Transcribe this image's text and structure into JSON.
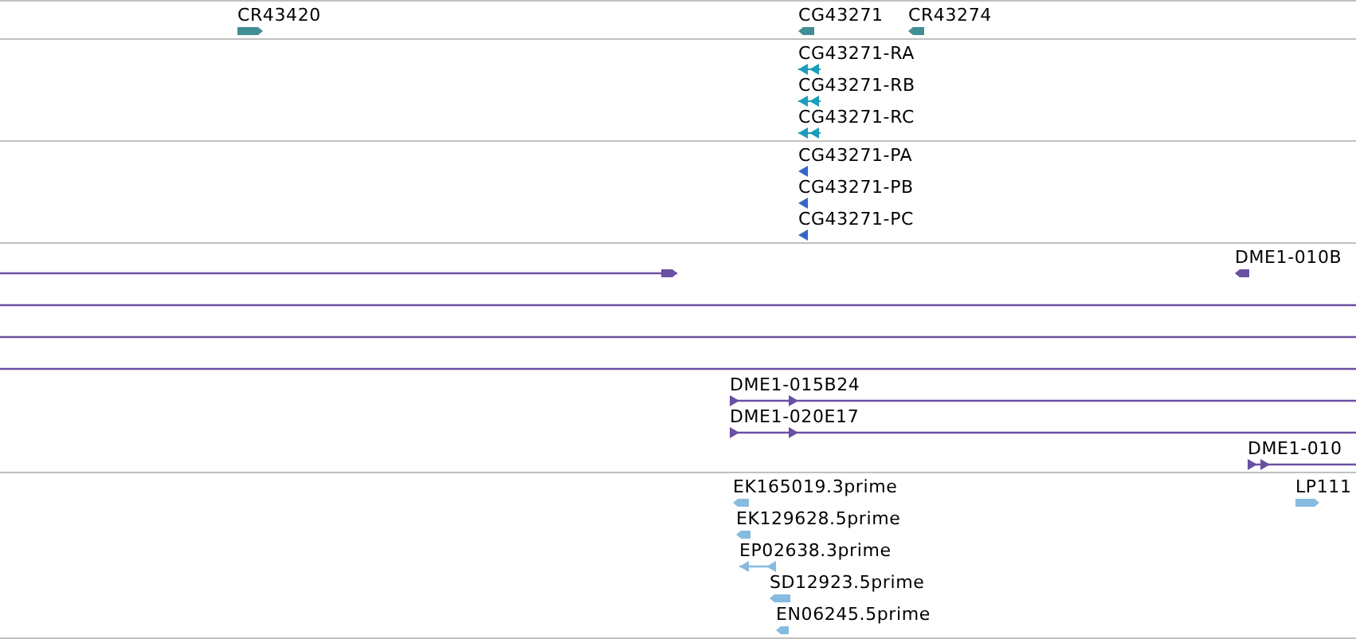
{
  "tracks": [
    {
      "color": "#3f8f94",
      "features": [
        {
          "label": "CR43420",
          "kind": "block",
          "reverse": false
        },
        {
          "label": "CG43271",
          "kind": "block",
          "reverse": true
        },
        {
          "label": "CR43274",
          "kind": "block",
          "reverse": true
        }
      ]
    },
    {
      "color": "#1a9dba",
      "features": [
        {
          "label": "CG43271-RA",
          "kind": "transcript",
          "reverse": true
        },
        {
          "label": "CG43271-RB",
          "kind": "transcript",
          "reverse": true
        },
        {
          "label": "CG43271-RC",
          "kind": "transcript",
          "reverse": true
        }
      ]
    },
    {
      "color": "#3366cc",
      "features": [
        {
          "label": "CG43271-PA",
          "kind": "cds",
          "reverse": true
        },
        {
          "label": "CG43271-PB",
          "kind": "cds",
          "reverse": true
        },
        {
          "label": "CG43271-PC",
          "kind": "cds",
          "reverse": true
        }
      ]
    },
    {
      "color": "#6a50a2",
      "features": [
        {
          "kind": "line",
          "reverse": false
        },
        {
          "label": "DME1-010B",
          "kind": "block",
          "reverse": true
        },
        {
          "kind": "plain"
        },
        {
          "kind": "plain"
        },
        {
          "kind": "plain"
        },
        {
          "label": "DME1-015B24",
          "kind": "line",
          "reverse": false
        },
        {
          "label": "DME1-020E17",
          "kind": "line",
          "reverse": false
        },
        {
          "label": "DME1-010",
          "kind": "line",
          "reverse": false
        }
      ]
    },
    {
      "color": "#88bbe0",
      "features": [
        {
          "label": "EK165019.3prime",
          "kind": "block",
          "reverse": true
        },
        {
          "label": "EK129628.5prime",
          "kind": "block",
          "reverse": true
        },
        {
          "label": "EP02638.3prime",
          "kind": "line",
          "reverse": true
        },
        {
          "label": "SD12923.5prime",
          "kind": "block",
          "reverse": true
        },
        {
          "label": "EN06245.5prime",
          "kind": "block",
          "reverse": true
        },
        {
          "label": "LP111",
          "kind": "block",
          "reverse": false
        }
      ]
    }
  ]
}
